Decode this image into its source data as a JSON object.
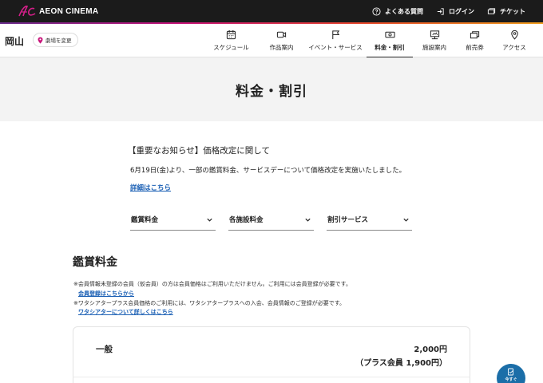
{
  "brand": {
    "logo_text": "AEON CINEMA"
  },
  "top_links": [
    {
      "label": "よくある質問",
      "icon": "help-circle-icon"
    },
    {
      "label": "ログイン",
      "icon": "login-icon"
    },
    {
      "label": "チケット",
      "icon": "ticket-icon"
    }
  ],
  "header": {
    "city": "岡山",
    "change_theater": "劇場を変更"
  },
  "nav": [
    {
      "label": "スケジュール",
      "icon": "calendar-icon"
    },
    {
      "label": "作品案内",
      "icon": "video-camera-icon"
    },
    {
      "label": "イベント・サービス",
      "icon": "flag-icon"
    },
    {
      "label": "料金・割引",
      "icon": "money-icon",
      "active": true
    },
    {
      "label": "施設案内",
      "icon": "screen-icon"
    },
    {
      "label": "前売券",
      "icon": "tickets-icon"
    },
    {
      "label": "アクセス",
      "icon": "map-pin-icon"
    }
  ],
  "page_title": "料金・割引",
  "notice": {
    "title": "【重要なお知らせ】価格改定に関して",
    "body": "6月19日(金)より、一部の鑑賞料金、サービスデーについて価格改定を実施いたしました。",
    "link": "詳細はこちら"
  },
  "dropdowns": [
    "鑑賞料金",
    "各施設料金",
    "割引サービス"
  ],
  "section": {
    "title": "鑑賞料金",
    "note1": "※会員情報未登録の会員（仮会員）の方は会員価格はご利用いただけません。ご利用には会員登録が必要です。",
    "link1": "会員登録はこちらから",
    "note2": "※ワタシアタープラス会員価格のご利用には、ワタシアタープラスへの入会、会員情報のご登録が必要です。",
    "link2": "ワタシアターについて詳しくはこちら"
  },
  "price_rows": [
    {
      "label": "一般",
      "price": "2,000円",
      "member_price": "（プラス会員 1,900円）"
    }
  ],
  "fab": {
    "label": "今すぐ"
  },
  "colors": {
    "accent": "#1a5fb4",
    "topbar": "#1b1b1b",
    "fab": "#1b6ea8",
    "band": "#f3f3f3"
  }
}
